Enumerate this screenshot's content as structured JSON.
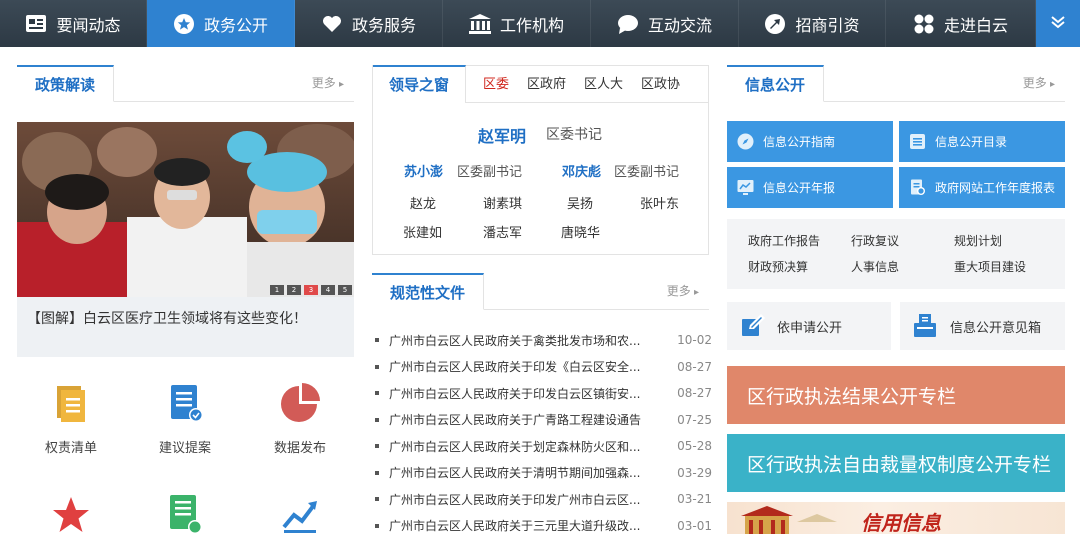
{
  "nav": {
    "items": [
      {
        "label": "要闻动态",
        "icon": "news-icon"
      },
      {
        "label": "政务公开",
        "icon": "star-circle-icon"
      },
      {
        "label": "政务服务",
        "icon": "heart-icon"
      },
      {
        "label": "工作机构",
        "icon": "building-icon"
      },
      {
        "label": "互动交流",
        "icon": "chat-icon"
      },
      {
        "label": "招商引资",
        "icon": "arrow-circle-icon"
      },
      {
        "label": "走进白云",
        "icon": "grid-icon"
      }
    ],
    "active_index": 1,
    "more_icon": "double-chevron-down-icon"
  },
  "policy": {
    "title": "政策解读",
    "more": "更多",
    "caption": "【图解】白云区医疗卫生领域将有这些变化！",
    "pager": [
      "1",
      "2",
      "3",
      "4",
      "5"
    ],
    "pager_active": 3
  },
  "shortcuts": [
    {
      "label": "权责清单",
      "icon": "document-list-icon"
    },
    {
      "label": "建议提案",
      "icon": "document-check-icon"
    },
    {
      "label": "数据发布",
      "icon": "pie-chart-icon"
    },
    {
      "label": "",
      "icon": "star-icon"
    },
    {
      "label": "",
      "icon": "document-five-icon"
    },
    {
      "label": "",
      "icon": "trend-up-icon"
    }
  ],
  "leaders": {
    "tabs": [
      "领导之窗",
      "区委",
      "区政府",
      "区人大",
      "区政协"
    ],
    "chief": {
      "name": "赵军明",
      "title": "区委书记"
    },
    "deputies": [
      {
        "name": "苏小澎",
        "title": "区委副书记"
      },
      {
        "name": "邓庆彪",
        "title": "区委副书记"
      }
    ],
    "members_row1": [
      "赵龙",
      "谢素琪",
      "吴扬",
      "张叶东"
    ],
    "members_row2": [
      "张建如",
      "潘志军",
      "唐晓华"
    ]
  },
  "documents": {
    "title": "规范性文件",
    "more": "更多",
    "items": [
      {
        "title": "广州市白云区人民政府关于禽类批发市场和农...",
        "date": "10-02"
      },
      {
        "title": "广州市白云区人民政府关于印发《白云区安全...",
        "date": "08-27"
      },
      {
        "title": "广州市白云区人民政府关于印发白云区镇街安...",
        "date": "08-27"
      },
      {
        "title": "广州市白云区人民政府关于广青路工程建设通告",
        "date": "07-25"
      },
      {
        "title": "广州市白云区人民政府关于划定森林防火区和...",
        "date": "05-28"
      },
      {
        "title": "广州市白云区人民政府关于清明节期间加强森...",
        "date": "03-29"
      },
      {
        "title": "广州市白云区人民政府关于印发广州市白云区...",
        "date": "03-21"
      },
      {
        "title": "广州市白云区人民政府关于三元里大道升级改...",
        "date": "03-01"
      }
    ]
  },
  "info": {
    "title": "信息公开",
    "more": "更多",
    "buttons": [
      {
        "label": "信息公开指南",
        "icon": "compass-icon"
      },
      {
        "label": "信息公开目录",
        "icon": "list-icon"
      },
      {
        "label": "信息公开年报",
        "icon": "monitor-chart-icon"
      },
      {
        "label": "政府网站工作年度报表",
        "icon": "report-icon"
      }
    ],
    "links": [
      "政府工作报告",
      "行政复议",
      "规划计划",
      "财政预决算",
      "人事信息",
      "重大项目建设"
    ],
    "apply": {
      "label": "依申请公开",
      "icon": "edit-icon"
    },
    "mailbox": {
      "label": "信息公开意见箱",
      "icon": "mailbox-icon"
    },
    "banners": [
      {
        "label": "区行政执法结果公开专栏",
        "color": "#e0876a"
      },
      {
        "label": "区行政执法自由裁量权制度公开专栏",
        "color": "#3ab2c8"
      }
    ],
    "credit_text": "信用信息"
  },
  "colors": {
    "accent": "#2f82d0",
    "nav_bg": "#2d3944",
    "red": "#d0271d"
  }
}
